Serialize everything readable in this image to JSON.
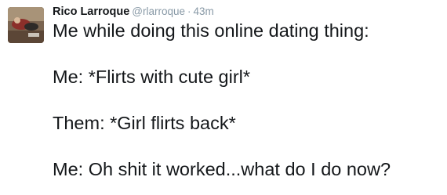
{
  "tweet": {
    "author": {
      "name": "Rico Larroque",
      "handle": "@rlarroque",
      "separator": "·",
      "time": "43m"
    },
    "avatar_icon": "profile-photo",
    "lines": [
      "Me while doing this online dating thing:",
      "Me: *Flirts with cute girl*",
      "Them: *Girl flirts back*",
      "Me: Oh shit it worked...what do I do now?"
    ]
  }
}
